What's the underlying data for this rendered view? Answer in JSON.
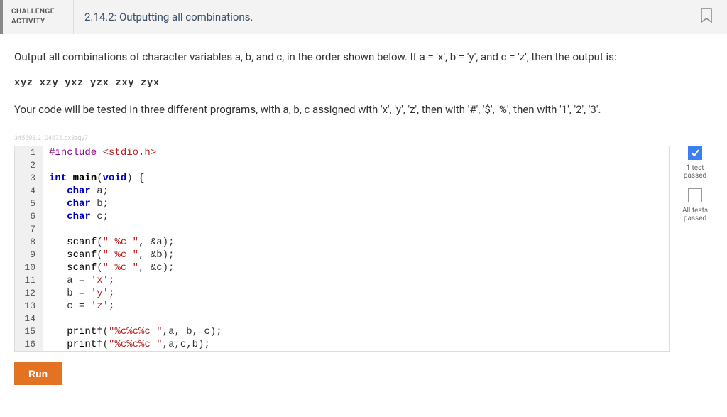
{
  "header": {
    "label_line1": "CHALLENGE",
    "label_line2": "ACTIVITY",
    "title": "2.14.2: Outputting all combinations."
  },
  "description": {
    "p1": "Output all combinations of character variables a, b, and c, in the order shown below. If a = 'x', b = 'y', and c = 'z', then the output is:",
    "example_output": "xyz xzy yxz yzx zxy zyx",
    "p2": "Your code will be tested in three different programs, with a, b, c assigned with 'x', 'y', 'z', then with '#', '$', '%', then with '1', '2', '3'."
  },
  "watermark": "345598.2104676.qx3zqy7",
  "code": {
    "line_numbers": [
      "1",
      "2",
      "3",
      "4",
      "5",
      "6",
      "7",
      "8",
      "9",
      "10",
      "11",
      "12",
      "13",
      "14",
      "15",
      "16"
    ],
    "l1_preproc": "#include",
    "l1_header": " <stdio.h>",
    "l3_type": "int",
    "l3_main": " main",
    "l3_rest": "(",
    "l3_void": "void",
    "l3_rest2": ") {",
    "l4_type": "char",
    "l4_rest": " a;",
    "l5_type": "char",
    "l5_rest": " b;",
    "l6_type": "char",
    "l6_rest": " c;",
    "l8_fn": "scanf",
    "l8_p": "(",
    "l8_str": "\" %c \"",
    "l8_rest": ", &a);",
    "l9_fn": "scanf",
    "l9_p": "(",
    "l9_str": "\" %c \"",
    "l9_rest": ", &b);",
    "l10_fn": "scanf",
    "l10_p": "(",
    "l10_str": "\" %c \"",
    "l10_rest": ", &c);",
    "l11_lhs": "a = ",
    "l11_char": "'x'",
    "l11_semi": ";",
    "l12_lhs": "b = ",
    "l12_char": "'y'",
    "l12_semi": ";",
    "l13_lhs": "c = ",
    "l13_char": "'z'",
    "l13_semi": ";",
    "l15_fn": "printf",
    "l15_p": "(",
    "l15_str": "\"%c%c%c \"",
    "l15_rest": ",a, b, c);",
    "l16_fn": "printf",
    "l16_p": "(",
    "l16_str": "\"%c%c%c \"",
    "l16_rest": ",a,c,b);"
  },
  "status": {
    "one_test_l1": "1 test",
    "one_test_l2": "passed",
    "all_tests_l1": "All tests",
    "all_tests_l2": "passed"
  },
  "run_label": "Run"
}
